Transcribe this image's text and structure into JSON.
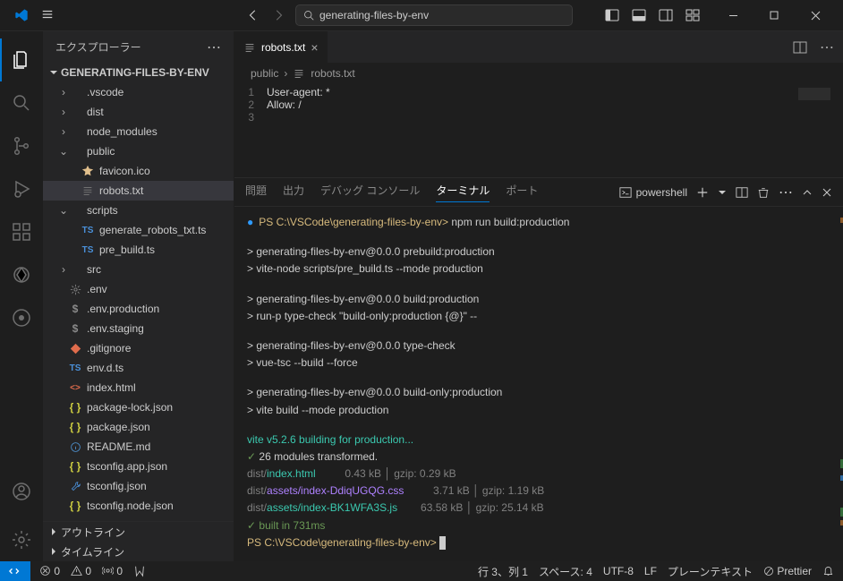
{
  "title_search": "generating-files-by-env",
  "sidebar": {
    "title": "エクスプローラー",
    "root": "GENERATING-FILES-BY-ENV",
    "outline": "アウトライン",
    "timeline": "タイムライン"
  },
  "tree": [
    {
      "name": ".vscode",
      "type": "folder",
      "depth": 1,
      "open": false
    },
    {
      "name": "dist",
      "type": "folder",
      "depth": 1,
      "open": false
    },
    {
      "name": "node_modules",
      "type": "folder",
      "depth": 1,
      "open": false
    },
    {
      "name": "public",
      "type": "folder",
      "depth": 1,
      "open": true
    },
    {
      "name": "favicon.ico",
      "type": "file",
      "depth": 2,
      "icon": "star",
      "color": "#e2c08d"
    },
    {
      "name": "robots.txt",
      "type": "file",
      "depth": 2,
      "icon": "lines",
      "color": "#7a7a7a",
      "selected": true
    },
    {
      "name": "scripts",
      "type": "folder",
      "depth": 1,
      "open": true
    },
    {
      "name": "generate_robots_txt.ts",
      "type": "file",
      "depth": 2,
      "icon": "ts",
      "color": "#4a90d9"
    },
    {
      "name": "pre_build.ts",
      "type": "file",
      "depth": 2,
      "icon": "ts",
      "color": "#4a90d9"
    },
    {
      "name": "src",
      "type": "folder",
      "depth": 1,
      "open": false
    },
    {
      "name": ".env",
      "type": "file",
      "depth": 1,
      "icon": "gear",
      "color": "#8a8a8a"
    },
    {
      "name": ".env.production",
      "type": "file",
      "depth": 1,
      "icon": "dollar",
      "color": "#8a8a8a"
    },
    {
      "name": ".env.staging",
      "type": "file",
      "depth": 1,
      "icon": "dollar",
      "color": "#8a8a8a"
    },
    {
      "name": ".gitignore",
      "type": "file",
      "depth": 1,
      "icon": "git",
      "color": "#e06c4c"
    },
    {
      "name": "env.d.ts",
      "type": "file",
      "depth": 1,
      "icon": "ts",
      "color": "#4a90d9"
    },
    {
      "name": "index.html",
      "type": "file",
      "depth": 1,
      "icon": "html",
      "color": "#e06c4c"
    },
    {
      "name": "package-lock.json",
      "type": "file",
      "depth": 1,
      "icon": "braces",
      "color": "#cbcb41"
    },
    {
      "name": "package.json",
      "type": "file",
      "depth": 1,
      "icon": "braces",
      "color": "#cbcb41"
    },
    {
      "name": "README.md",
      "type": "file",
      "depth": 1,
      "icon": "info",
      "color": "#5098d8"
    },
    {
      "name": "tsconfig.app.json",
      "type": "file",
      "depth": 1,
      "icon": "braces",
      "color": "#cbcb41"
    },
    {
      "name": "tsconfig.json",
      "type": "file",
      "depth": 1,
      "icon": "wrench",
      "color": "#4a90d9"
    },
    {
      "name": "tsconfig.node.json",
      "type": "file",
      "depth": 1,
      "icon": "braces",
      "color": "#cbcb41"
    }
  ],
  "tab": {
    "name": "robots.txt"
  },
  "breadcrumb": {
    "folder": "public",
    "file": "robots.txt"
  },
  "editor": {
    "lines": [
      "User-agent: *",
      "Allow: /",
      ""
    ]
  },
  "panel": {
    "tabs": {
      "problems": "問題",
      "output": "出力",
      "debug": "デバッグ コンソール",
      "terminal": "ターミナル",
      "ports": "ポート"
    },
    "shell": "powershell"
  },
  "terminal": {
    "prompt": "PS C:\\VSCode\\generating-files-by-env>",
    "cmd": "npm run build:production",
    "blocks": [
      [
        "> generating-files-by-env@0.0.0 prebuild:production",
        "> vite-node scripts/pre_build.ts --mode production"
      ],
      [
        "> generating-files-by-env@0.0.0 build:production",
        "> run-p type-check \"build-only:production {@}\" --"
      ],
      [
        "> generating-files-by-env@0.0.0 type-check",
        "> vue-tsc --build --force"
      ],
      [
        "> generating-files-by-env@0.0.0 build-only:production",
        "> vite build --mode production"
      ]
    ],
    "vite": "vite v5.2.6 building for production...",
    "transformed": "26 modules transformed.",
    "files": [
      {
        "path": "dist/",
        "name": "index.html",
        "size": "0.43 kB",
        "gzip": "gzip:   0.29 kB",
        "color": "#3bc9b0"
      },
      {
        "path": "dist/",
        "name": "assets/index-DdiqUGQG.css",
        "size": "3.71 kB",
        "gzip": "gzip:   1.19 kB",
        "color": "#ae81ff"
      },
      {
        "path": "dist/",
        "name": "assets/index-BK1WFA3S.js",
        "size": "63.58 kB",
        "gzip": "gzip:  25.14 kB",
        "color": "#3bc9b0"
      }
    ],
    "built": "built in 731ms"
  },
  "status": {
    "errors": "0",
    "warnings": "0",
    "ports": "0",
    "line": "行 3、列 1",
    "spaces": "スペース: 4",
    "encoding": "UTF-8",
    "eol": "LF",
    "lang": "プレーンテキスト",
    "prettier": "Prettier"
  }
}
